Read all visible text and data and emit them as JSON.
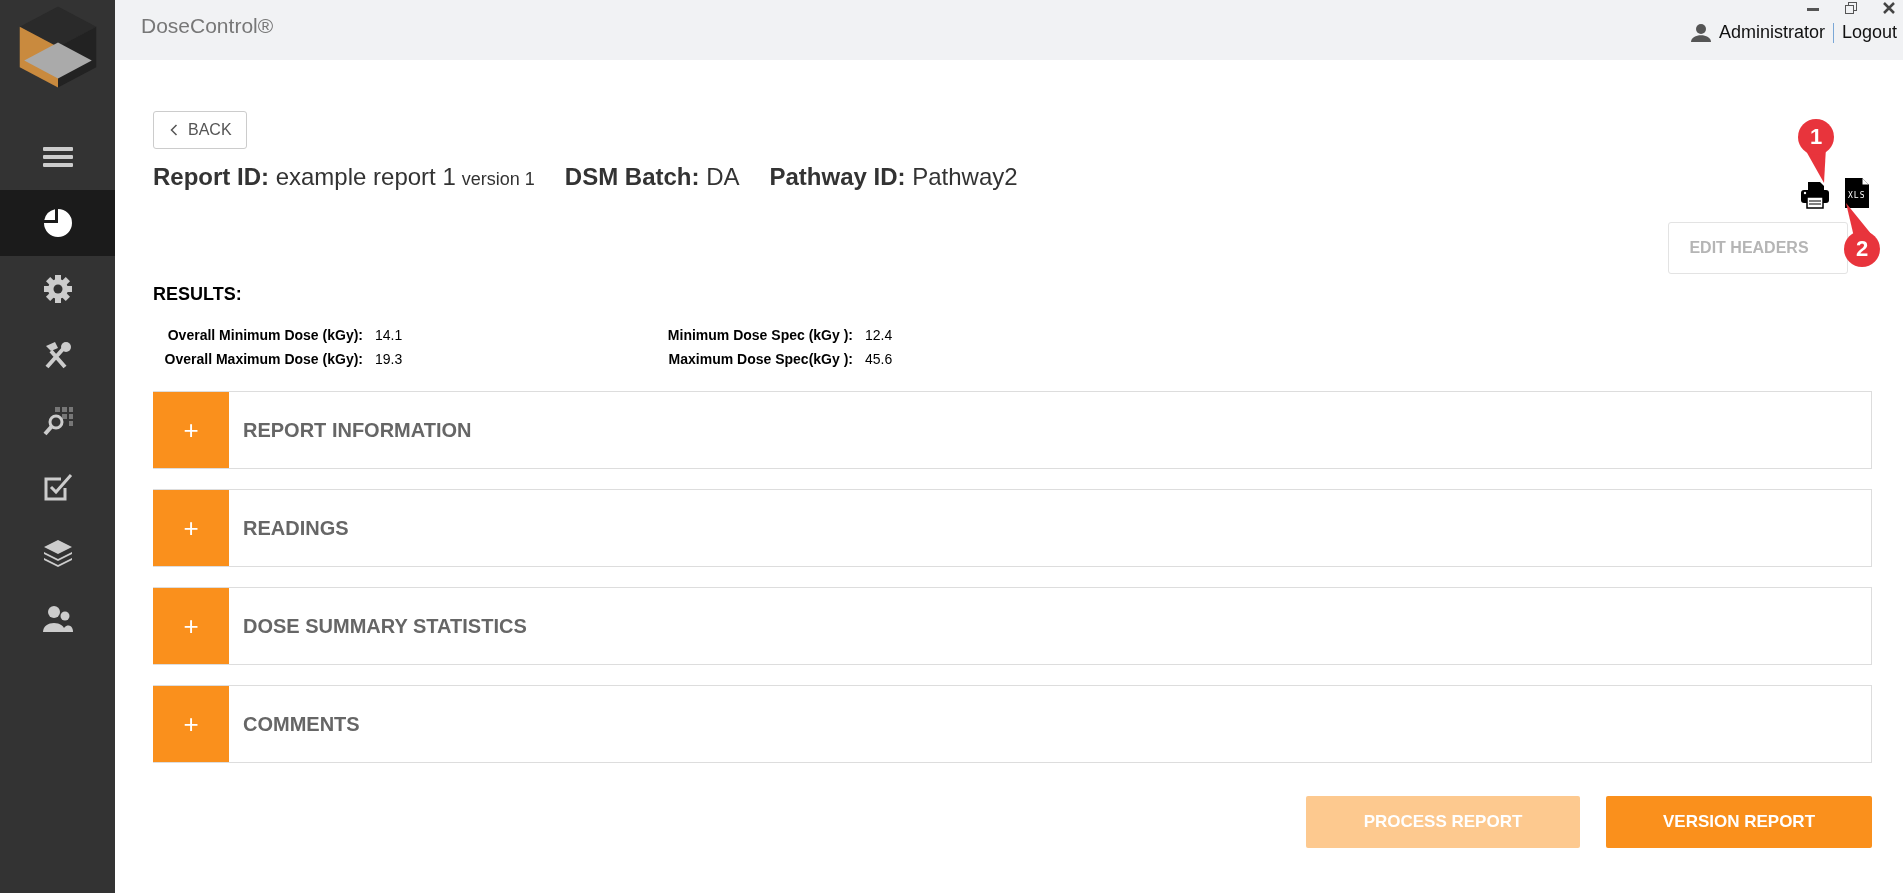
{
  "app": {
    "title": "DoseControl®"
  },
  "window_controls": [
    {
      "kind": "minimize"
    },
    {
      "kind": "restore"
    },
    {
      "kind": "close"
    }
  ],
  "user": {
    "name": "Administrator",
    "logout": "Logout"
  },
  "sidebar": {
    "items": [
      {
        "kind": "menu",
        "selected": false
      },
      {
        "kind": "pie",
        "selected": true
      },
      {
        "kind": "gear",
        "selected": false
      },
      {
        "kind": "tools",
        "selected": false
      },
      {
        "kind": "search",
        "selected": false
      },
      {
        "kind": "checkbox",
        "selected": false
      },
      {
        "kind": "layers",
        "selected": false
      },
      {
        "kind": "users",
        "selected": false
      }
    ]
  },
  "back_button": "BACK",
  "header": [
    {
      "label": "Report ID:",
      "value": "example report 1",
      "suffix": "version 1"
    },
    {
      "label": "DSM Batch:",
      "value": "DA"
    },
    {
      "label": "Pathway ID:",
      "value": "Pathway2"
    }
  ],
  "export_icons": [
    {
      "kind": "printer"
    },
    {
      "kind": "file",
      "label": "XLS"
    }
  ],
  "callouts": [
    {
      "label": "1"
    },
    {
      "label": "2"
    }
  ],
  "edit_headers": {
    "label": "EDIT HEADERS",
    "disabled": true
  },
  "results": {
    "title": "RESULTS:",
    "columns": [
      [
        {
          "label": "Overall Minimum Dose (kGy):",
          "value": "14.1"
        },
        {
          "label": "Overall Maximum Dose (kGy):",
          "value": "19.3"
        }
      ],
      [
        {
          "label": "Minimum Dose Spec (kGy ):",
          "value": "12.4"
        },
        {
          "label": "Maximum Dose Spec(kGy ):",
          "value": "45.6"
        }
      ]
    ]
  },
  "sections": [
    {
      "toggle": "+",
      "title": "REPORT INFORMATION",
      "expanded": false
    },
    {
      "toggle": "+",
      "title": "READINGS",
      "expanded": false
    },
    {
      "toggle": "+",
      "title": "DOSE SUMMARY STATISTICS",
      "expanded": false
    },
    {
      "toggle": "+",
      "title": "COMMENTS",
      "expanded": false
    }
  ],
  "actions": [
    {
      "label": "PROCESS REPORT",
      "disabled": true
    },
    {
      "label": "VERSION REPORT",
      "disabled": false
    }
  ]
}
